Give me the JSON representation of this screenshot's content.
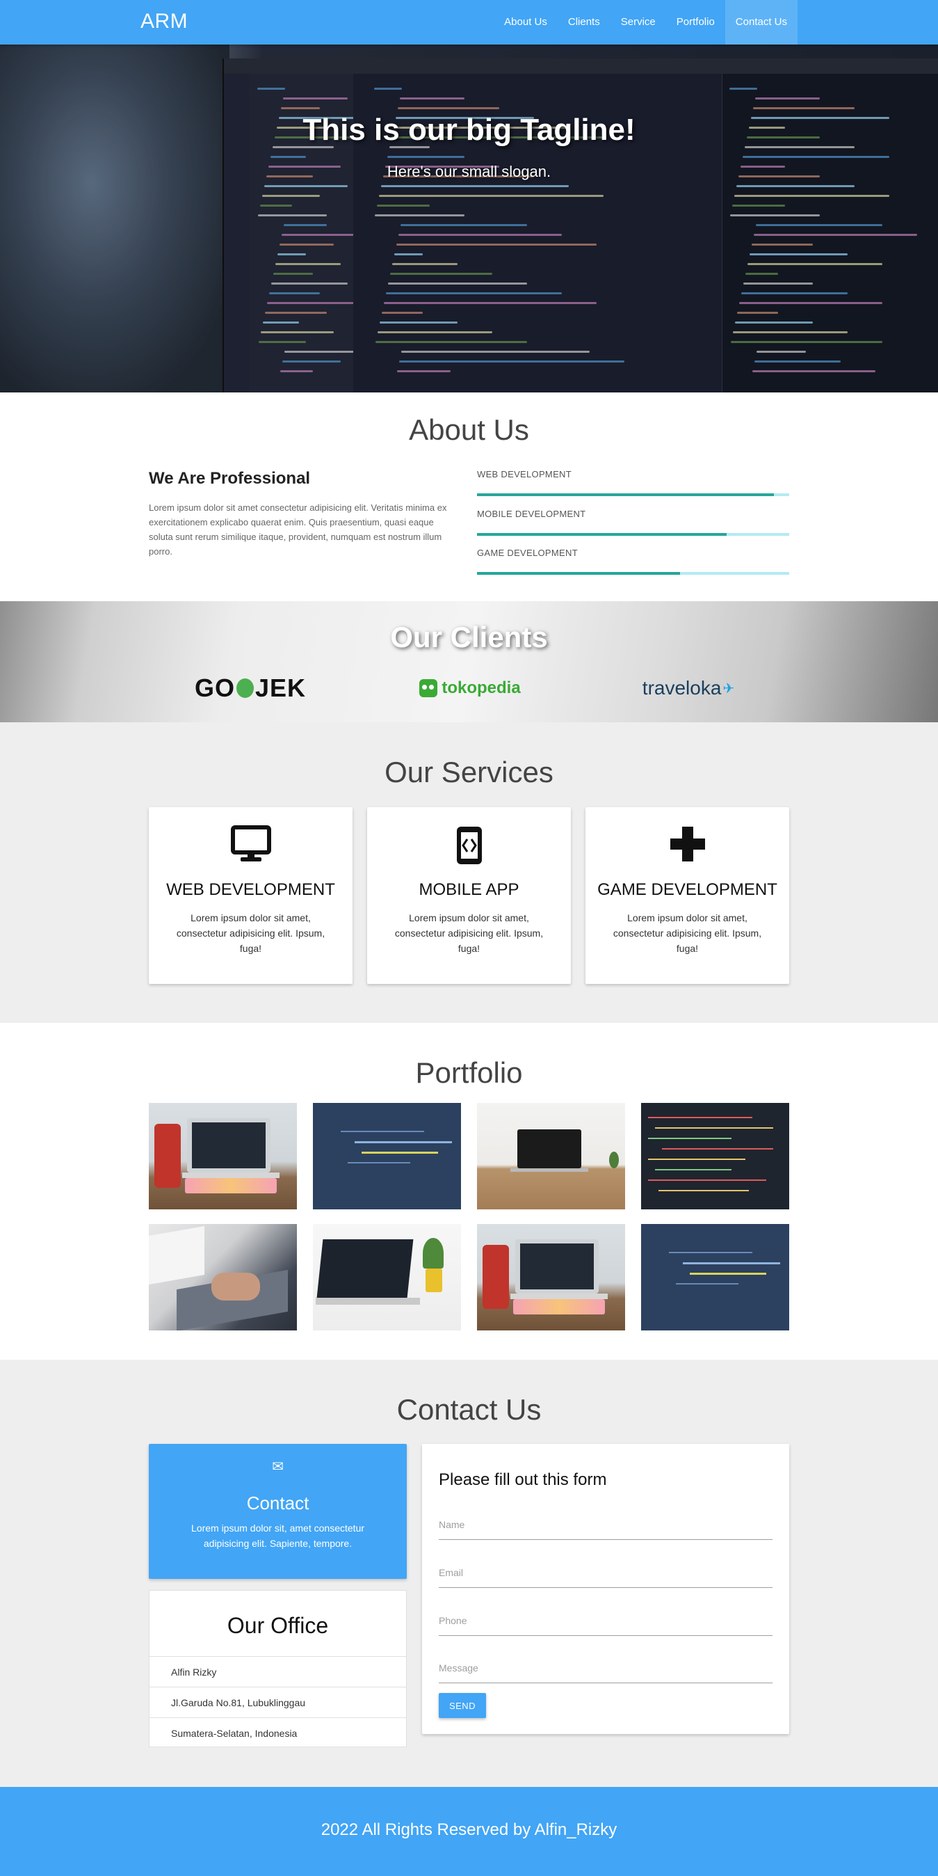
{
  "navbar": {
    "brand": "ARM",
    "links": [
      "About Us",
      "Clients",
      "Service",
      "Portfolio",
      "Contact Us"
    ],
    "active_link": "Contact Us",
    "color": "#42a5f5"
  },
  "hero": {
    "tagline": "This is our big Tagline!",
    "slogan": "Here's our small slogan."
  },
  "about": {
    "title": "About Us",
    "heading": "We Are Professional",
    "paragraph": "Lorem ipsum dolor sit amet consectetur adipisicing elit. Veritatis minima ex exercitationem explicabo quaerat enim. Quis praesentium, quasi eaque soluta sunt rerum similique itaque, provident, numquam est nostrum illum porro.",
    "skills": [
      {
        "label": "WEB DEVELOPMENT",
        "level": 0.95
      },
      {
        "label": "MOBILE DEVELOPMENT",
        "level": 0.8
      },
      {
        "label": "GAME DEVELOPMENT",
        "level": 0.65
      }
    ]
  },
  "clients": {
    "title": "Our Clients",
    "logos": [
      "GOJEK",
      "tokopedia",
      "traveloka"
    ]
  },
  "services": {
    "title": "Our Services",
    "items": [
      {
        "title": "WEB DEVELOPMENT",
        "text": "Lorem ipsum dolor sit amet, consectetur adipisicing elit. Ipsum, fuga!",
        "icon": "desktop-icon"
      },
      {
        "title": "MOBILE APP",
        "text": "Lorem ipsum dolor sit amet, consectetur adipisicing elit. Ipsum, fuga!",
        "icon": "mobile-code-icon"
      },
      {
        "title": "GAME DEVELOPMENT",
        "text": "Lorem ipsum dolor sit amet, consectetur adipisicing elit. Ipsum, fuga!",
        "icon": "gamepad-icon"
      }
    ]
  },
  "portfolio": {
    "title": "Portfolio",
    "thumbnails": [
      "laptop-keyboard-photo",
      "code-screen-photo",
      "laptop-desk-photo",
      "code-monitor-photo",
      "typing-laptop-photo",
      "laptop-plant-photo",
      "laptop-keyboard-photo",
      "code-screen-photo"
    ]
  },
  "contact": {
    "title": "Contact Us",
    "card_title": "Contact",
    "card_text": "Lorem ipsum dolor sit, amet consectetur adipisicing elit. Sapiente, tempore.",
    "office_title": "Our Office",
    "office_items": [
      "Alfin Rizky",
      "Jl.Garuda No.81, Lubuklinggau",
      "Sumatera-Selatan, Indonesia"
    ],
    "form_title": "Please fill out this form",
    "placeholders": {
      "name": "Name",
      "email": "Email",
      "phone": "Phone",
      "message": "Message"
    },
    "send_label": "SEND"
  },
  "footer": {
    "text": "2022 All Rights Reserved by Alfin_Rizky"
  }
}
